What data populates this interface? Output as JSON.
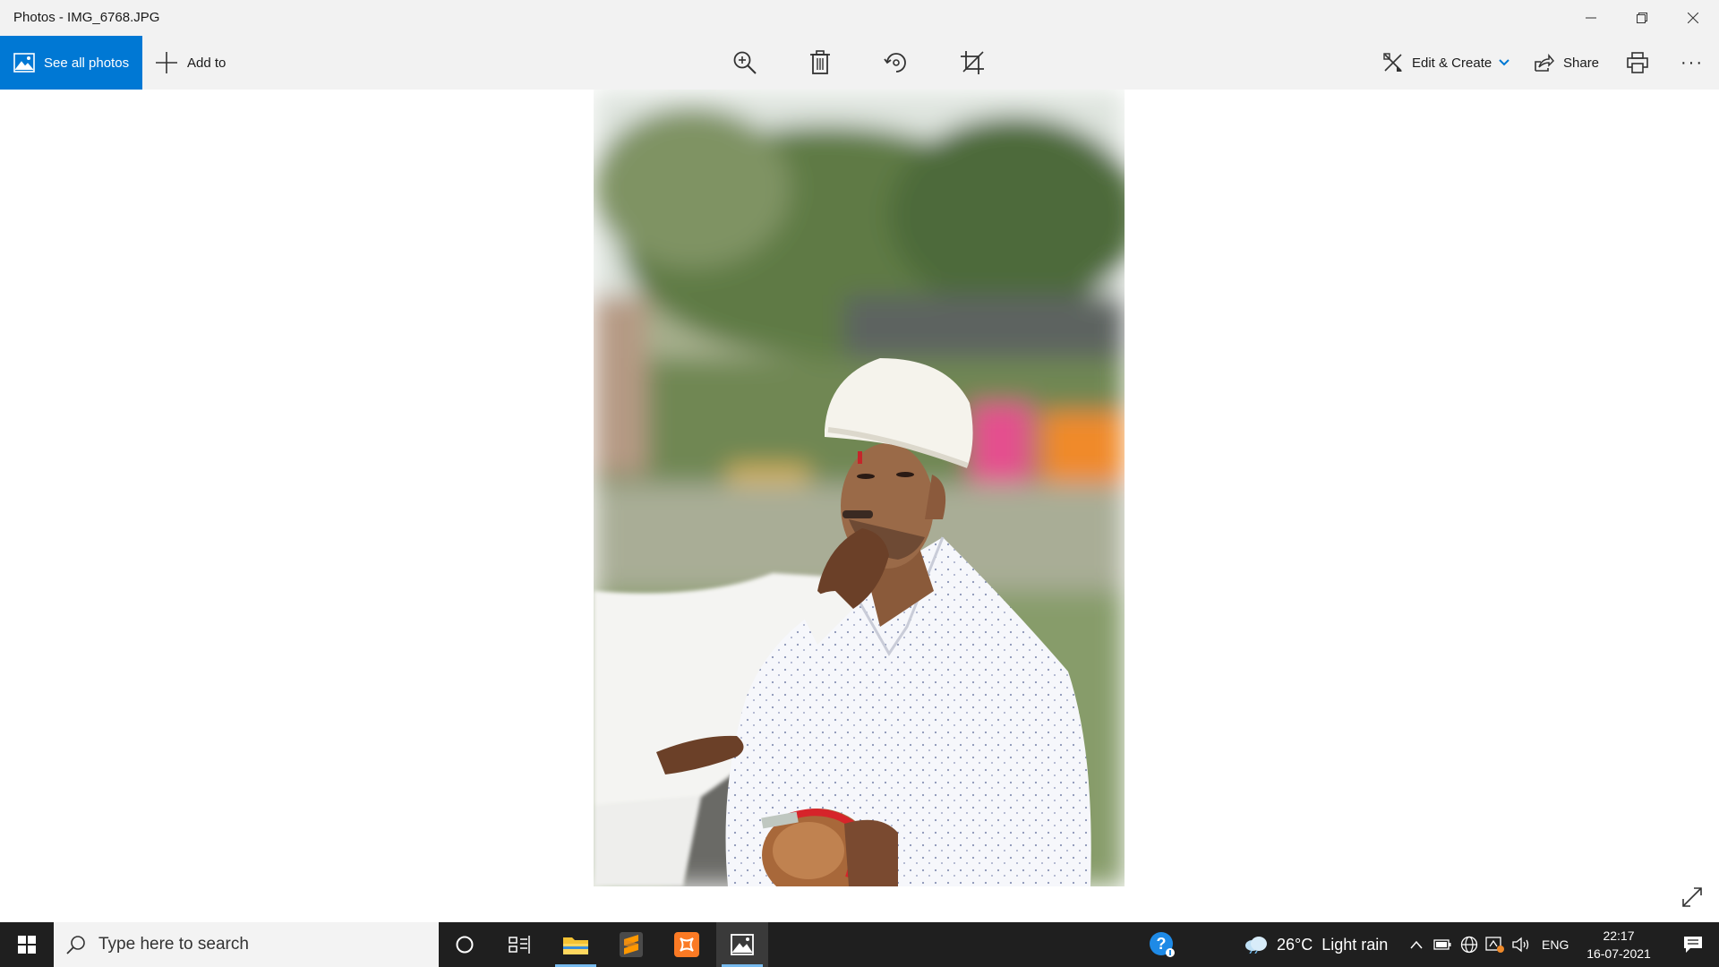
{
  "window": {
    "title": "Photos - IMG_6768.JPG"
  },
  "toolbar": {
    "see_all_photos": "See all photos",
    "add_to": "Add to",
    "edit_create": "Edit & Create",
    "share": "Share",
    "more": "···",
    "icons": [
      "zoom-in-icon",
      "delete-icon",
      "rotate-icon",
      "crop-icon",
      "print-icon"
    ]
  },
  "photo": {
    "description_icon": "photo-of-man-in-white-fur-cap"
  },
  "taskbar": {
    "search_placeholder": "Type here to search",
    "weather": "26°C  Light rain",
    "language": "ENG",
    "time": "22:17",
    "date": "16-07-2021"
  },
  "colors": {
    "accent": "#0078d4",
    "taskbar": "#1f1f1f",
    "chrome": "#f2f2f2"
  }
}
